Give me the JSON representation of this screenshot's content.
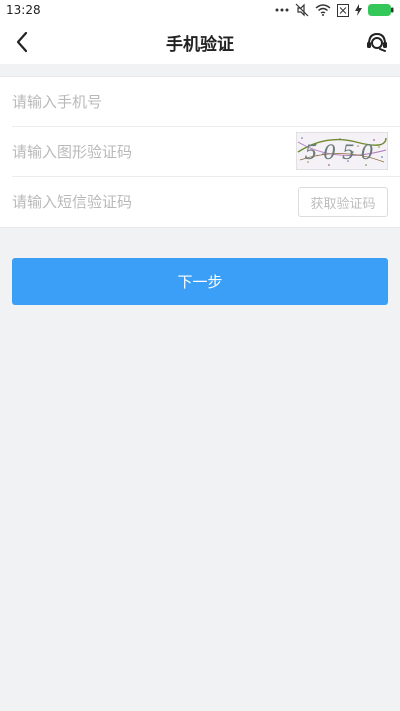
{
  "status_bar": {
    "time": "13:28",
    "icons": [
      "more-dots-icon",
      "mute-icon",
      "wifi-icon",
      "sim-icon",
      "battery-icon"
    ],
    "battery_color": "#34c759"
  },
  "nav": {
    "title": "手机验证",
    "back_icon": "chevron-left-icon",
    "right_icon": "customer-service-icon"
  },
  "form": {
    "phone_placeholder": "请输入手机号",
    "captcha_placeholder": "请输入图形验证码",
    "captcha_text": "5050",
    "sms_placeholder": "请输入短信验证码",
    "sms_button_label": "获取验证码"
  },
  "next_button_label": "下一步",
  "colors": {
    "accent": "#3b9ff8",
    "background": "#f1f2f4"
  }
}
